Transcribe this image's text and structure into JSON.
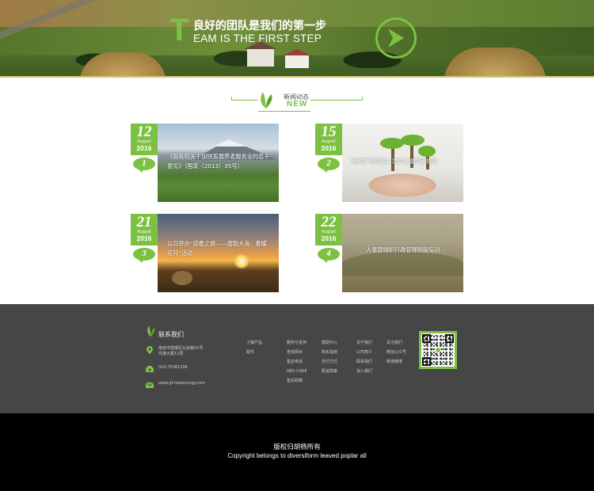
{
  "hero": {
    "title_initial": "T",
    "title_cn": "良好的团队是我们的第一步",
    "title_en": "EAM IS THE FIRST STEP",
    "arrow_icon": "arrow-right-icon"
  },
  "news_section": {
    "title_cn": "新闻动态",
    "title_en": "NEW",
    "items": [
      {
        "day": "12",
        "month": "August",
        "year": "2016",
        "number": "1",
        "caption": "《国务院关于加快发展养老服务业的若干意见》（国发〔2013〕35号）"
      },
      {
        "day": "15",
        "month": "August",
        "year": "2016",
        "number": "2",
        "caption": "新政扩建住宅二次供水或同步规用"
      },
      {
        "day": "21",
        "month": "August",
        "year": "2016",
        "number": "3",
        "caption": "公司举办“迎春之旅——面朝大海，春暖花开”活动"
      },
      {
        "day": "22",
        "month": "August",
        "year": "2016",
        "number": "4",
        "caption": "人事部组织行政管理制度培训"
      }
    ]
  },
  "footer": {
    "contact_title": "联系我们",
    "address_line1": "南京市鼓楼区北京路20号",
    "address_line2": "鸿港大厦12层",
    "phone": "010-76381296",
    "website": "www.gf-newenergy.com",
    "columns": [
      [
        "了解产品",
        "配件"
      ],
      [
        "服务与支持",
        "查找网点",
        "售后电话",
        "NEU CARE",
        "售后政策"
      ],
      [
        "帮助中心",
        "购买指南",
        "支付方式",
        "配送政策"
      ],
      [
        "关于我们",
        "公司简介",
        "联系我们",
        "加入我们"
      ],
      [
        "关注我们",
        "微信公众号",
        "新浪微博"
      ]
    ]
  },
  "copyright": {
    "cn": "版权归胡杨所有",
    "en": "Copyright belongs to diversiform leaved poplar all"
  },
  "colors": {
    "accent": "#7dc143",
    "footer_bg": "#464646",
    "copyright_bg": "#000000"
  }
}
